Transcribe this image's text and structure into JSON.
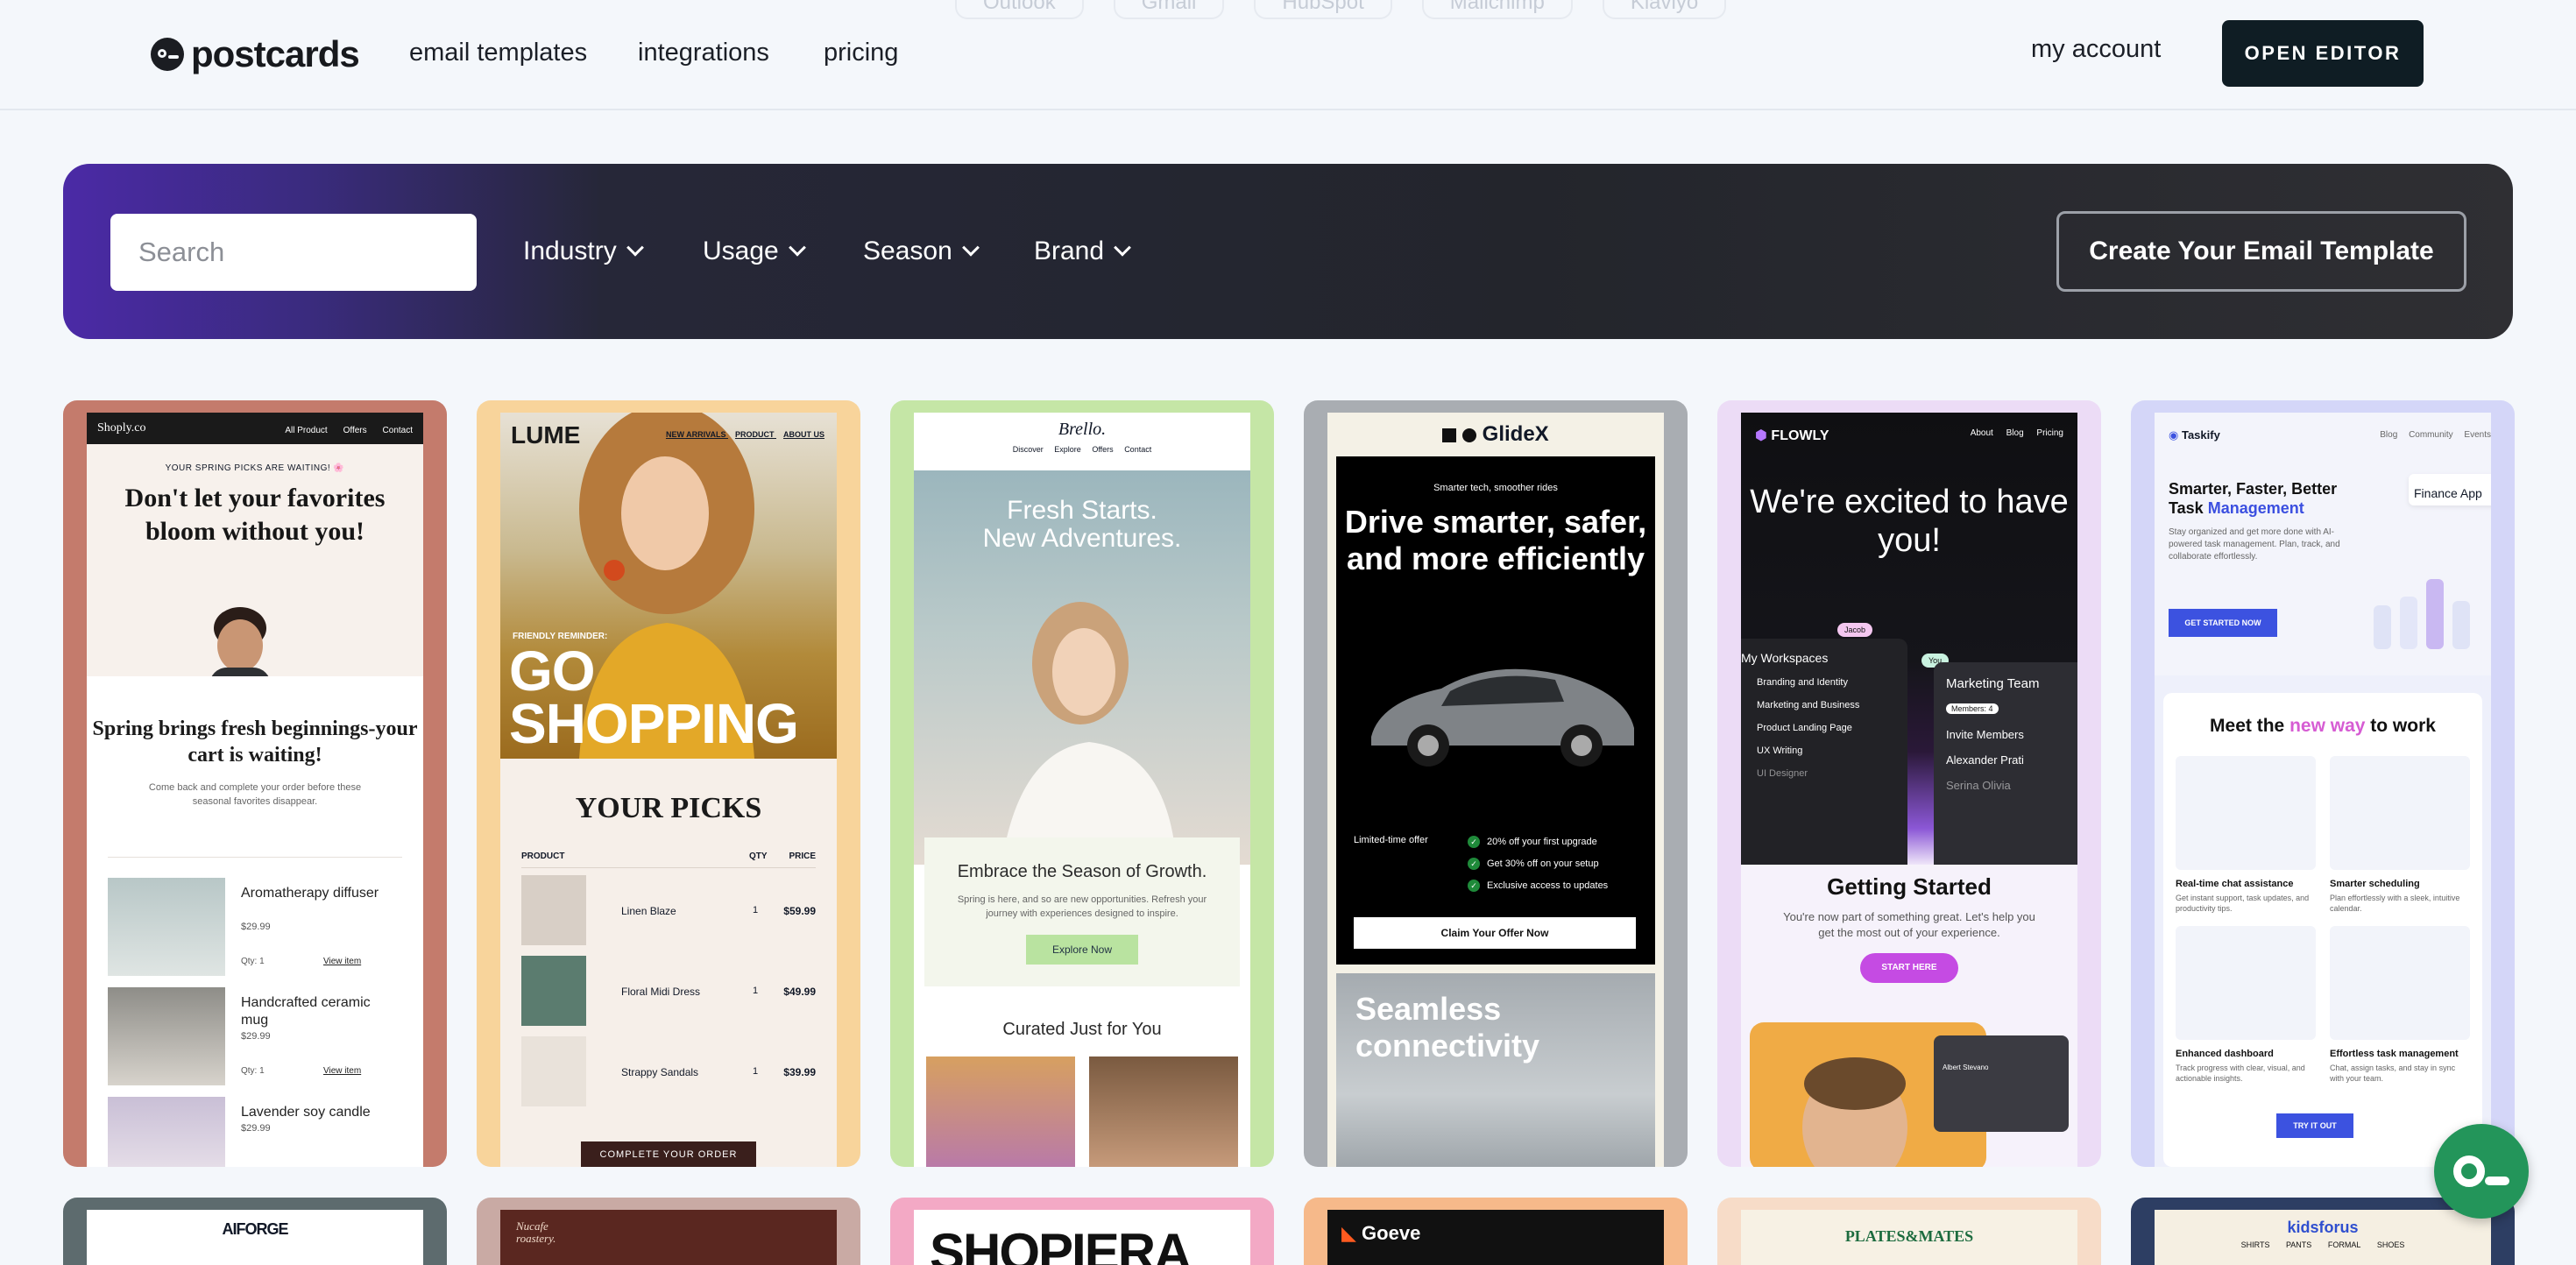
{
  "header": {
    "logo_text": "postcards",
    "nav": [
      "email templates",
      "integrations",
      "pricing"
    ],
    "ghost_tabs": [
      "Outlook",
      "Gmail",
      "HubSpot",
      "Mailchimp",
      "Klaviyo"
    ],
    "account": "my account",
    "open_editor": "OPEN EDITOR"
  },
  "filters": {
    "search_placeholder": "Search",
    "dropdowns": [
      "Industry",
      "Usage",
      "Season",
      "Brand"
    ],
    "create_button": "Create Your Email Template"
  },
  "cards": [
    {
      "border_color": "#c47b6c",
      "brand": "Shoply.co",
      "nav": [
        "All Product",
        "Offers",
        "Contact"
      ],
      "eyebrow": "YOUR SPRING PICKS ARE WAITING! 🌸",
      "headline": "Don't let your favorites bloom without you!",
      "subhead": "Spring brings fresh beginnings-your cart is waiting!",
      "body": "Come back and complete your order before these seasonal favorites disappear.",
      "qty_label": "Qty: 1",
      "view_label": "View item",
      "products": [
        {
          "name": "Aromatherapy diffuser",
          "price": "$29.99"
        },
        {
          "name": "Handcrafted ceramic mug",
          "price": "$29.99"
        },
        {
          "name": "Lavender soy candle",
          "price": "$29.99"
        }
      ]
    },
    {
      "border_color": "#f8d49b",
      "brand": "LUME",
      "nav": [
        "NEW ARRIVALS",
        "PRODUCT",
        "ABOUT US"
      ],
      "eyebrow": "FRIENDLY REMINDER:",
      "headline_1": "GO",
      "headline_2": "SHOPPING",
      "section": "YOUR PICKS",
      "cols": [
        "PRODUCT",
        "QTY",
        "PRICE"
      ],
      "rows": [
        {
          "name": "Linen Blaze",
          "qty": "1",
          "price": "$59.99"
        },
        {
          "name": "Floral Midi Dress",
          "qty": "1",
          "price": "$49.99"
        },
        {
          "name": "Strappy Sandals",
          "qty": "1",
          "price": "$39.99"
        }
      ],
      "cta": "COMPLETE YOUR ORDER"
    },
    {
      "border_color": "#c5e6a6",
      "brand": "Brello.",
      "nav": [
        "Discover",
        "Explore",
        "Offers",
        "Contact"
      ],
      "headline_1": "Fresh Starts.",
      "headline_2": "New Adventures.",
      "box_title": "Embrace the Season of Growth.",
      "box_body": "Spring is here, and so are new opportunities. Refresh your journey with experiences designed to inspire.",
      "box_button": "Explore Now",
      "curated": "Curated Just for You"
    },
    {
      "border_color": "#a9adb2",
      "brand": "GlideX",
      "eyebrow": "Smarter tech, smoother rides",
      "headline": "Drive smarter, safer, and more efficiently",
      "left_note": "Limited-time offer",
      "bullets": [
        "20% off your first upgrade",
        "Get 30% off on your setup",
        "Exclusive access to updates"
      ],
      "cta": "Claim Your Offer Now",
      "section": "Seamless connectivity"
    },
    {
      "border_color": "#ecdcf6",
      "brand": "FLOWLY",
      "nav": [
        "About",
        "Blog",
        "Pricing"
      ],
      "headline": "We're excited to have you!",
      "workspace_title": "My Workspaces",
      "workspaces": [
        "Branding and Identity",
        "Marketing and Business",
        "Product Landing Page",
        "UX Writing",
        "UI Designer"
      ],
      "team_title": "Marketing Team",
      "members_badge": "Members: 4",
      "invite": "Invite Members",
      "people": [
        "Alexander Prati",
        "Serina Olivia"
      ],
      "badge_jacob": "Jacob",
      "badge_you": "You",
      "section": "Getting Started",
      "body": "You're now part of something great. Let's help you get the most out of your experience.",
      "cta": "START HERE",
      "contact_name": "Albert Stevano"
    },
    {
      "border_color": "#d4d6f8",
      "brand": "Taskify",
      "nav": [
        "Blog",
        "Community",
        "Events"
      ],
      "headline_1": "Smarter, Faster, Better Task",
      "headline_2": "Management",
      "body": "Stay organized and get more done with AI-powered task management. Plan, track, and collaborate effortlessly.",
      "cta": "GET STARTED NOW",
      "mock_card": "Finance App",
      "section_1": "Meet the",
      "section_2": "new way",
      "section_3": "to work",
      "features": [
        {
          "title": "Real-time chat assistance",
          "desc": "Get instant support, task updates, and productivity tips."
        },
        {
          "title": "Smarter scheduling",
          "desc": "Plan effortlessly with a sleek, intuitive calendar."
        },
        {
          "title": "Enhanced dashboard",
          "desc": "Track progress with clear, visual, and actionable insights."
        },
        {
          "title": "Effortless task management",
          "desc": "Chat, assign tasks, and stay in sync with your team."
        }
      ],
      "try": "TRY IT OUT"
    }
  ],
  "row2": [
    {
      "label": "AIFORGE",
      "border": "#5d6b6e",
      "bg": "#ffffff",
      "color": "#111"
    },
    {
      "label": "Nucafe roastery.",
      "border": "#c9aaa4",
      "bg": "#5a2720",
      "color": "#f0d9c8"
    },
    {
      "label": "SHOPIERA",
      "border": "#f3a9c5",
      "bg": "#ffffff",
      "color": "#111"
    },
    {
      "label": "Goeve",
      "border": "#f6b98a",
      "bg": "#111111",
      "color": "#ffffff"
    },
    {
      "label": "PLATES&MATES",
      "border": "#f7dcc8",
      "bg": "#f7f1e4",
      "color": "#1c6b3e"
    },
    {
      "label": "kidsforus",
      "border": "#2d3e63",
      "bg": "#f5efe2",
      "color": "#2f4fcf"
    }
  ],
  "row2_nav_6": [
    "SHIRTS",
    "PANTS",
    "FORMAL",
    "SHOES"
  ]
}
